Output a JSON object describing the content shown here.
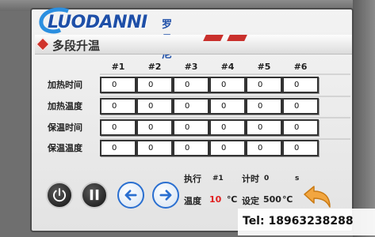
{
  "logo": {
    "brand": "LUODANNI",
    "brand_cn": "罗丹尼"
  },
  "header": {
    "title": "多段升温"
  },
  "grid": {
    "columns": [
      "#1",
      "#2",
      "#3",
      "#4",
      "#5",
      "#6"
    ],
    "rows": [
      {
        "label": "加热时间",
        "values": [
          "0",
          "0",
          "0",
          "0",
          "0",
          "0"
        ]
      },
      {
        "label": "加热温度",
        "values": [
          "0",
          "0",
          "0",
          "0",
          "0",
          "0"
        ]
      },
      {
        "label": "保温时间",
        "values": [
          "0",
          "0",
          "0",
          "0",
          "0",
          "0"
        ]
      },
      {
        "label": "保温温度",
        "values": [
          "0",
          "0",
          "0",
          "0",
          "0",
          "0"
        ]
      }
    ]
  },
  "status": {
    "exec_label": "执行",
    "exec_value": "#1",
    "timer_label": "计时",
    "timer_value": "0",
    "timer_unit": "s",
    "temp_label": "温度",
    "temp_value": "10",
    "temp_unit": "℃",
    "setpoint_label": "设定",
    "setpoint_value": "500",
    "setpoint_unit": "℃"
  },
  "controls": {
    "power_icon": "power-icon",
    "pause_icon": "pause-icon",
    "prev_icon": "arrow-left-icon",
    "next_icon": "arrow-right-icon",
    "back_icon": "return-arrow-icon"
  },
  "contact": {
    "tel": "Tel: 18963238288"
  },
  "colors": {
    "accent_blue": "#2a6fd0",
    "alert_red": "#e02020",
    "back_arrow": "#f2a640"
  }
}
